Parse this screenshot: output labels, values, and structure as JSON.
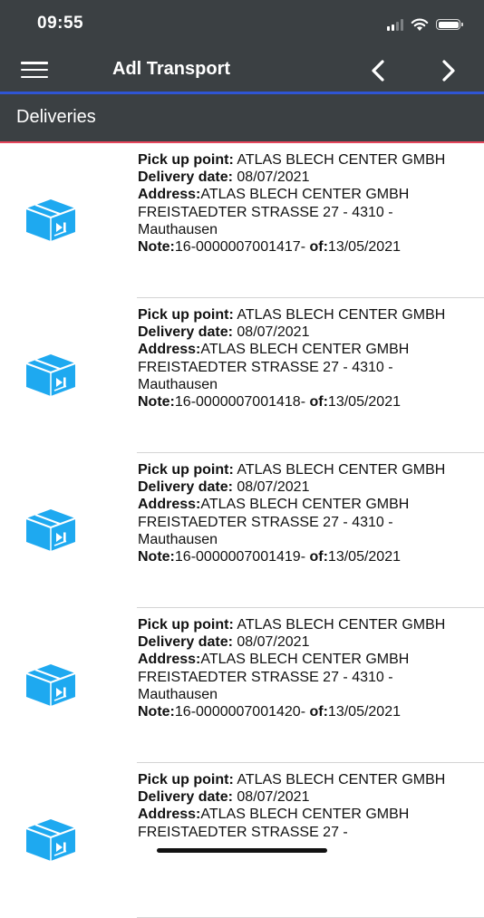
{
  "status_bar": {
    "time": "09:55"
  },
  "nav": {
    "title": "Adl Transport",
    "menu_icon": "hamburger-menu-icon",
    "prev_icon": "chevron-left-icon",
    "next_icon": "chevron-right-icon"
  },
  "section": {
    "title": "Deliveries"
  },
  "labels": {
    "pickup": "Pick up point:",
    "delivery_date": "Delivery date:",
    "address": "Address:",
    "note": "Note:",
    "of": "of:"
  },
  "colors": {
    "bar_bg": "#3b4043",
    "nav_accent": "#2f55d4",
    "section_accent": "#e6465c",
    "box_icon": "#1ea9f0"
  },
  "deliveries": [
    {
      "pickup": "ATLAS BLECH CENTER GMBH",
      "delivery_date": "08/07/2021",
      "address": "ATLAS BLECH CENTER GMBH FREISTAEDTER STRASSE 27 - 4310 - Mauthausen",
      "note": "16-0000007001417-",
      "of": "13/05/2021"
    },
    {
      "pickup": "ATLAS BLECH CENTER GMBH",
      "delivery_date": "08/07/2021",
      "address": "ATLAS BLECH CENTER GMBH FREISTAEDTER STRASSE 27 - 4310 - Mauthausen",
      "note": "16-0000007001418-",
      "of": "13/05/2021"
    },
    {
      "pickup": "ATLAS BLECH CENTER GMBH",
      "delivery_date": "08/07/2021",
      "address": "ATLAS BLECH CENTER GMBH FREISTAEDTER STRASSE 27 - 4310 - Mauthausen",
      "note": "16-0000007001419-",
      "of": "13/05/2021"
    },
    {
      "pickup": "ATLAS BLECH CENTER GMBH",
      "delivery_date": "08/07/2021",
      "address": "ATLAS BLECH CENTER GMBH FREISTAEDTER STRASSE 27 - 4310 - Mauthausen",
      "note": "16-0000007001420-",
      "of": "13/05/2021"
    },
    {
      "pickup": "ATLAS BLECH CENTER GMBH",
      "delivery_date": "08/07/2021",
      "address": "ATLAS BLECH CENTER GMBH FREISTAEDTER STRASSE 27 -",
      "note": "",
      "of": ""
    }
  ]
}
